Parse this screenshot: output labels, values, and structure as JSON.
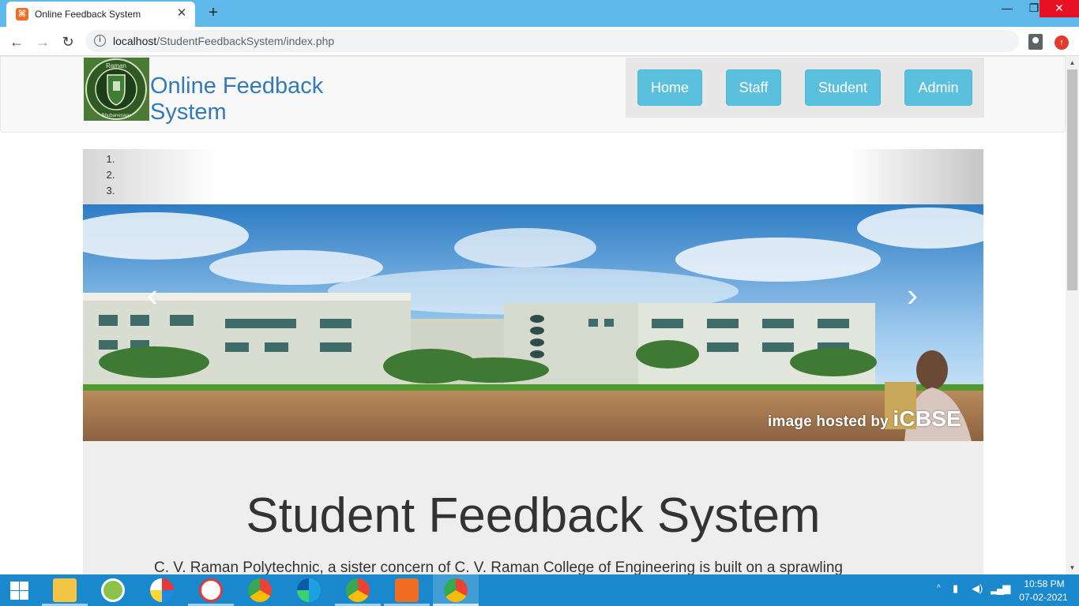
{
  "browser": {
    "tab_title": "Online Feedback System",
    "tab_close": "✕",
    "new_tab": "+",
    "url_host": "localhost",
    "url_path": "/StudentFeedbackSystem/index.php",
    "window": {
      "minimize": "—",
      "maximize": "❐",
      "close": "✕"
    },
    "nav": {
      "back": "←",
      "forward": "→",
      "reload": "↻"
    }
  },
  "site": {
    "brand_line1": "Online Feedback",
    "brand_line2": "System",
    "nav": [
      {
        "label": "Home"
      },
      {
        "label": "Staff"
      },
      {
        "label": "Student"
      },
      {
        "label": "Admin"
      }
    ],
    "carousel": {
      "indicators": [
        "",
        "",
        ""
      ],
      "prev": "‹",
      "next": "›",
      "watermark_small": "image hosted by ",
      "watermark_big": "iCBSE"
    },
    "jumbotron": {
      "title": "Student Feedback System",
      "text": "C. V. Raman Polytechnic, a sister concern of C. V. Raman College of Engineering is built on a sprawling"
    }
  },
  "taskbar": {
    "apps": [
      {
        "icon": "file-explorer-icon"
      },
      {
        "icon": "security-app-icon"
      },
      {
        "icon": "paint-app-icon"
      },
      {
        "icon": "snipping-tool-icon"
      },
      {
        "icon": "chrome-icon"
      },
      {
        "icon": "edge-icon"
      },
      {
        "icon": "chrome-icon"
      },
      {
        "icon": "xampp-icon"
      },
      {
        "icon": "chrome-icon"
      }
    ],
    "tray": {
      "chevron": "^",
      "time": "10:58 PM",
      "date": "07-02-2021"
    }
  },
  "colors": {
    "titlebar": "#5fb8ea",
    "brand": "#337ab7",
    "nav_button": "#5bc0de",
    "taskbar": "#1a88cc",
    "close": "#e81123"
  }
}
